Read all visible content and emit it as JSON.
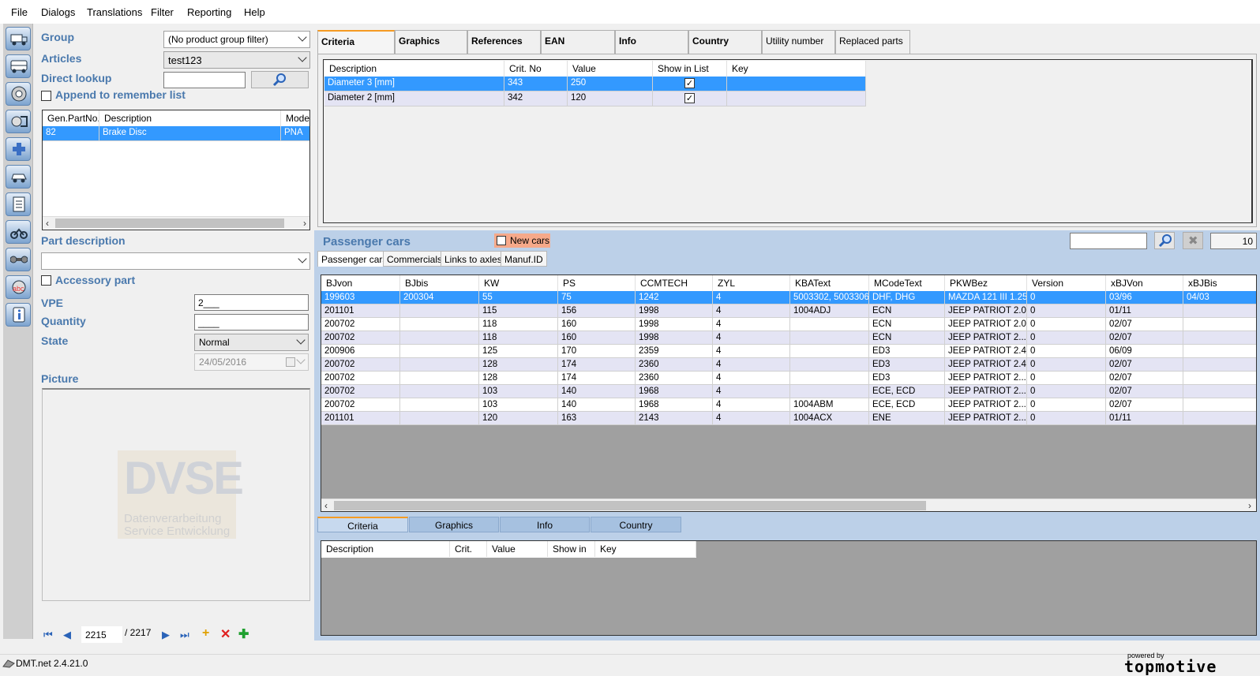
{
  "menu": [
    "File",
    "Dialogs",
    "Translations",
    "Filter",
    "Reporting",
    "Help"
  ],
  "left": {
    "group_label": "Group",
    "group_value": "(No product group filter)",
    "articles_label": "Articles",
    "articles_value": "test123",
    "direct_lookup_label": "Direct lookup",
    "direct_lookup_value": "",
    "append_label": "Append to remember list",
    "parts_table": {
      "headers": [
        "Gen.PartNo.",
        "Description",
        "Mode"
      ],
      "rows": [
        [
          "82",
          "Brake Disc",
          "PNA"
        ]
      ]
    },
    "part_description_label": "Part description",
    "part_description_value": "",
    "accessory_label": "Accessory part",
    "vpe_label": "VPE",
    "vpe_value": "2___",
    "quantity_label": "Quantity",
    "quantity_value": "____",
    "state_label": "State",
    "state_value": "Normal",
    "date_value": "24/05/2016",
    "picture_label": "Picture",
    "logo_text": "DVSE",
    "logo_sub1": "Datenverarbeitung",
    "logo_sub2": "Service Entwicklung",
    "nav_current": "2215",
    "nav_total": "/ 2217"
  },
  "top_tabs": [
    "Criteria",
    "Graphics",
    "References",
    "EAN",
    "Info",
    "Country",
    "Utility number",
    "Replaced parts"
  ],
  "criteria_table": {
    "headers": [
      "Description",
      "Crit. No",
      "Value",
      "Show in List",
      "Key"
    ],
    "rows": [
      [
        "Diameter 3 [mm]",
        "343",
        "250",
        true,
        ""
      ],
      [
        "Diameter 2 [mm]",
        "342",
        "120",
        true,
        ""
      ]
    ]
  },
  "cars": {
    "title": "Passenger cars",
    "new_cars_label": "New cars",
    "search_value": "",
    "count": "10",
    "sub_tabs": [
      "Passenger cars",
      "Commercials",
      "Links to axles",
      "Manuf.ID"
    ],
    "headers": [
      "BJvon",
      "BJbis",
      "KW",
      "PS",
      "CCMTECH",
      "ZYL",
      "KBAText",
      "MCodeText",
      "PKWBez",
      "Version",
      "xBJVon",
      "xBJBis"
    ],
    "rows": [
      [
        "199603",
        "200304",
        "55",
        "75",
        "1242",
        "4",
        "5003302, 5003306",
        "DHF, DHG",
        "MAZDA 121 III 1.25",
        "0",
        "03/96",
        "04/03"
      ],
      [
        "201101",
        "",
        "115",
        "156",
        "1998",
        "4",
        "1004ADJ",
        "ECN",
        "JEEP PATRIOT 2.0",
        "0",
        "01/11",
        ""
      ],
      [
        "200702",
        "",
        "118",
        "160",
        "1998",
        "4",
        "",
        "ECN",
        "JEEP PATRIOT 2.0",
        "0",
        "02/07",
        ""
      ],
      [
        "200702",
        "",
        "118",
        "160",
        "1998",
        "4",
        "",
        "ECN",
        "JEEP PATRIOT 2....",
        "0",
        "02/07",
        ""
      ],
      [
        "200906",
        "",
        "125",
        "170",
        "2359",
        "4",
        "",
        "ED3",
        "JEEP PATRIOT 2.4",
        "0",
        "06/09",
        ""
      ],
      [
        "200702",
        "",
        "128",
        "174",
        "2360",
        "4",
        "",
        "ED3",
        "JEEP PATRIOT 2.4",
        "0",
        "02/07",
        ""
      ],
      [
        "200702",
        "",
        "128",
        "174",
        "2360",
        "4",
        "",
        "ED3",
        "JEEP PATRIOT 2....",
        "0",
        "02/07",
        ""
      ],
      [
        "200702",
        "",
        "103",
        "140",
        "1968",
        "4",
        "",
        "ECE, ECD",
        "JEEP PATRIOT 2....",
        "0",
        "02/07",
        ""
      ],
      [
        "200702",
        "",
        "103",
        "140",
        "1968",
        "4",
        "1004ABM",
        "ECE, ECD",
        "JEEP PATRIOT 2....",
        "0",
        "02/07",
        ""
      ],
      [
        "201101",
        "",
        "120",
        "163",
        "2143",
        "4",
        "1004ACX",
        "ENE",
        "JEEP PATRIOT 2....",
        "0",
        "01/11",
        ""
      ]
    ]
  },
  "bottom_tabs": [
    "Criteria",
    "Graphics",
    "Info",
    "Country"
  ],
  "bottom_table_headers": [
    "Description",
    "Crit.",
    "Value",
    "Show in",
    "Key"
  ],
  "status": {
    "version": "DMT.net 2.4.21.0",
    "powered_by": "powered by",
    "brand": "topmotive"
  },
  "colors": {
    "accent": "#4a79ad",
    "selection": "#3399ff",
    "panel_blue": "#bcd0e8",
    "tab_accent": "#f59a23",
    "new_cars_bg": "#f6a98a"
  }
}
